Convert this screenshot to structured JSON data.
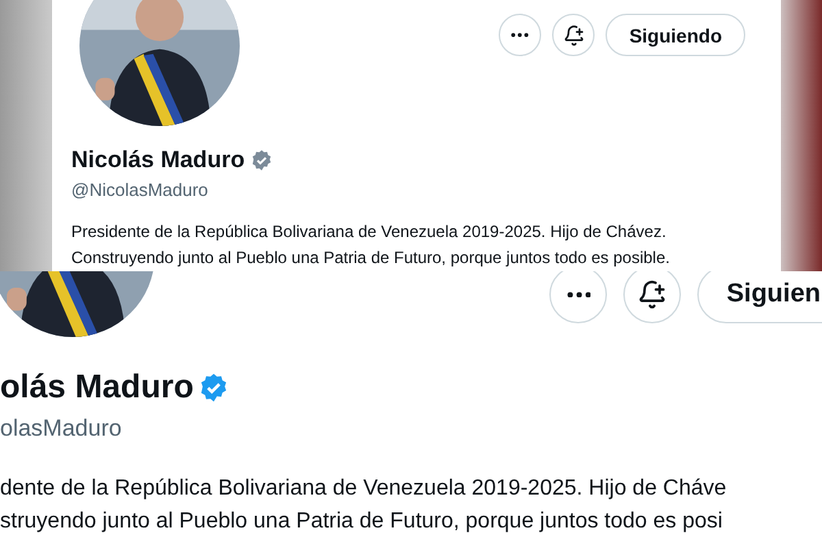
{
  "top": {
    "actions": [
      {
        "kind": "more"
      },
      {
        "kind": "notify"
      },
      {
        "kind": "follow",
        "label": "Siguiendo"
      }
    ],
    "name": "Nicolás Maduro",
    "verified": true,
    "handle": "@NicolasMaduro",
    "bio": [
      "Presidente de la República Bolivariana de Venezuela 2019-2025. Hijo de Chávez.",
      "Construyendo junto al Pueblo una Patria de Futuro, porque juntos todo es posible."
    ]
  },
  "bottom": {
    "actions": [
      {
        "kind": "more"
      },
      {
        "kind": "notify"
      },
      {
        "kind": "follow",
        "label": "Siguien"
      }
    ],
    "name": "olás Maduro",
    "verified": true,
    "handle": "olasMaduro",
    "bio": [
      "dente de la República Bolivariana de Venezuela 2019-2025. Hijo de Cháve",
      "struyendo junto al Pueblo una Patria de Futuro, porque juntos todo es posi"
    ]
  }
}
